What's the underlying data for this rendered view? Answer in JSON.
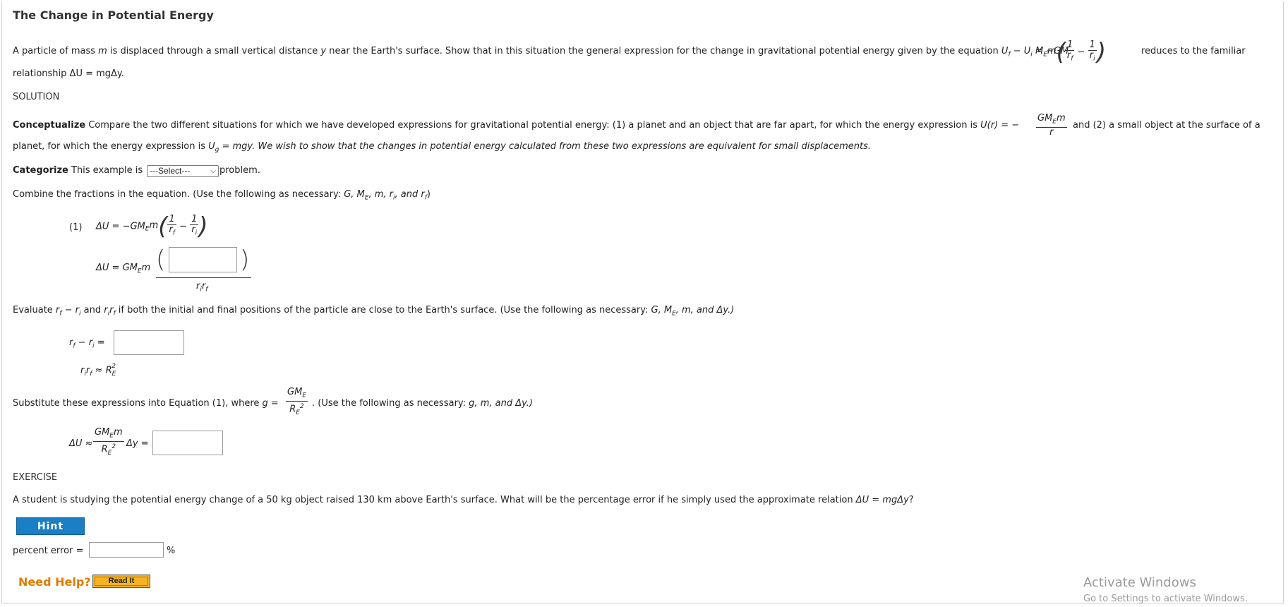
{
  "page": {
    "title": "The Change in Potential Energy"
  },
  "problem": {
    "intro_part1": "A particle of mass ",
    "intro_m": "m",
    "intro_part2": " is displaced through a small vertical distance ",
    "intro_y": "y",
    "intro_part3": " near the Earth's surface. Show that in this situation the general expression for the change in gravitational potential energy given by the equation ",
    "equation_lhs": "U",
    "equation_rhs": " = −GM",
    "equation_tail": " reduces to the familiar",
    "line2": "relationship ΔU = mgΔy."
  },
  "solution_heading": "SOLUTION",
  "conceptualize": {
    "label": "Conceptualize",
    "text1": " Compare the two different situations for which we have developed expressions for gravitational potential energy: (1) a planet and an object that are far apart, for which the energy expression is ",
    "U_of_r": "U(r) = −",
    "text2": " and (2) a small object at the surface of a",
    "line2_a": "planet, for which the energy expression is ",
    "line2_b": " = mgy. We wish to show that the changes in potential energy calculated from these two expressions are equivalent for small displacements."
  },
  "categorize": {
    "label": "Categorize",
    "text_before": " This example is ",
    "select_value": "---Select---",
    "text_after": " problem."
  },
  "combine": {
    "instruction": "Combine the fractions in the equation. (Use the following as necessary: ",
    "vars": "G, M",
    "vars_end": ", m, r",
    "tail": ")"
  },
  "equation1": {
    "number": "(1)",
    "lhs": "ΔU = −GM",
    "line2_lhs": "ΔU = GM",
    "denominator": "r"
  },
  "evaluate": {
    "instruction_a": "Evaluate ",
    "instruction_b": " and ",
    "instruction_c": " if both the initial and final positions of the particle are close to the Earth's surface. (Use the following as necessary: ",
    "instruction_vars": "G, M",
    "instruction_vars_end": ", m, and Δy.)",
    "row1_suffix": " =",
    "row2": "≈ R"
  },
  "substitute": {
    "instruction_a": "Substitute these expressions into Equation (1), where ",
    "g_eq": "g =",
    "instruction_b": ". (Use the following as necessary: ",
    "instruction_vars": "g, m, and Δy.)",
    "lhs": "ΔU ≈",
    "mid": "Δy ="
  },
  "exercise": {
    "heading": "EXERCISE",
    "text": "A student is studying the potential energy change of a 50 kg object raised 130 km above Earth's surface. What will be the percentage error if he simply used the approximate relation ",
    "relation": "ΔU = mgΔy",
    "text_end": "?",
    "hint_label": "Hint",
    "percent_label": "percent error =",
    "percent_unit": "%",
    "percent_value": ""
  },
  "help": {
    "label": "Need Help?",
    "read_it": "Read It"
  },
  "watermark": {
    "line1": "Activate Windows",
    "line2": "Go to Settings to activate Windows."
  }
}
